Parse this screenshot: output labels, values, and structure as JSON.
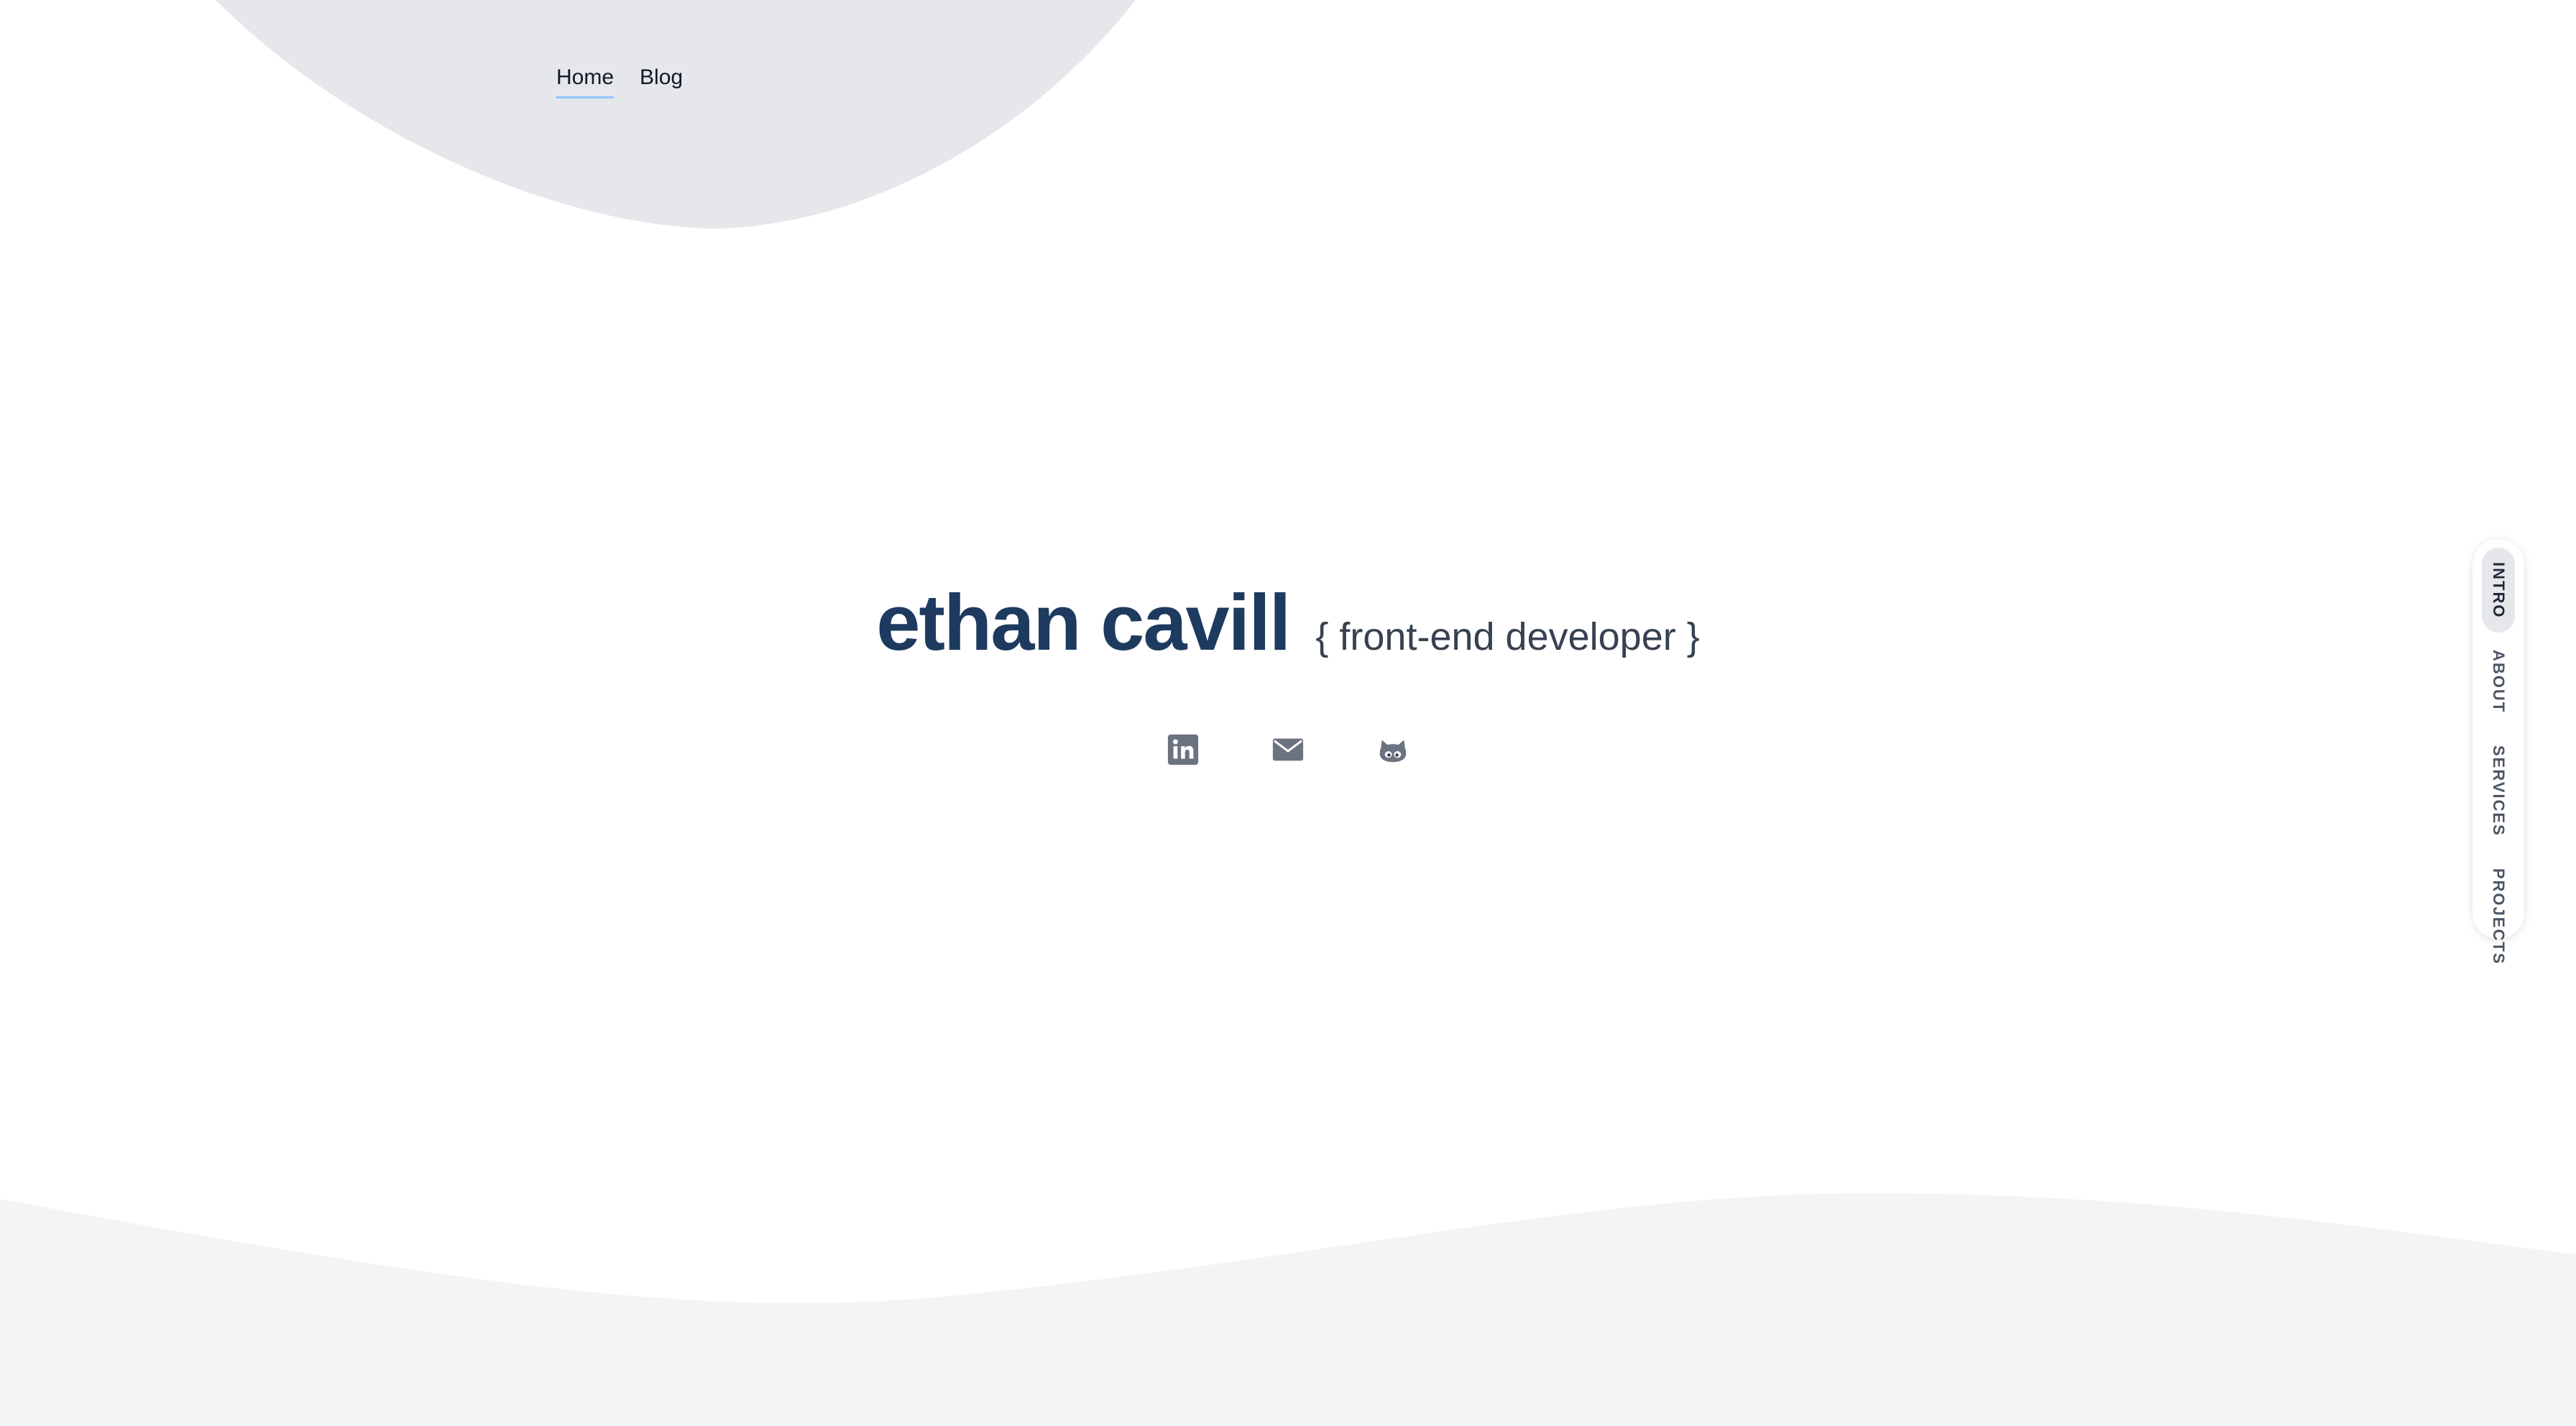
{
  "nav": {
    "links": [
      {
        "label": "Home",
        "active": true
      },
      {
        "label": "Blog",
        "active": false
      }
    ]
  },
  "hero": {
    "name": "ethan cavill",
    "role": "{ front-end developer }"
  },
  "socials": [
    {
      "icon": "linkedin-icon"
    },
    {
      "icon": "mail-icon"
    },
    {
      "icon": "github-icon"
    }
  ],
  "side_nav": {
    "items": [
      {
        "label": "INTRO",
        "active": true
      },
      {
        "label": "ABOUT",
        "active": false
      },
      {
        "label": "SERVICES",
        "active": false
      },
      {
        "label": "PROJECTS",
        "active": false
      }
    ]
  },
  "colors": {
    "name": "#1e3a5f",
    "blob": "#e5e7eb",
    "wave": "#f3f4f6",
    "active_underline": "#93c5fd",
    "icon": "#6b7280"
  }
}
